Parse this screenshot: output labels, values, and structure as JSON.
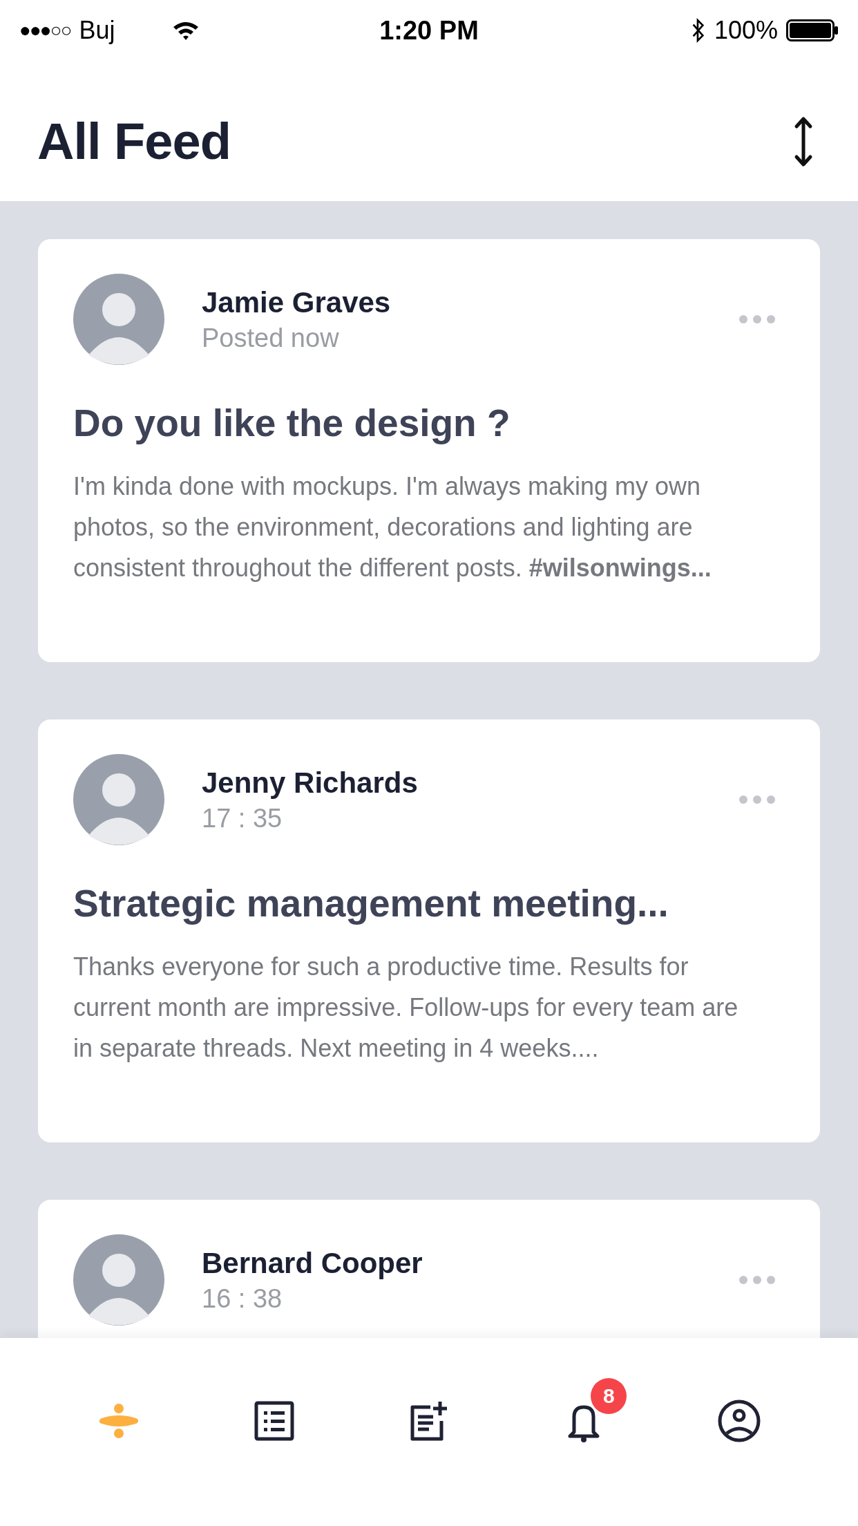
{
  "status_bar": {
    "signal_text": "●●●○○",
    "carrier": "Buj",
    "time": "1:20 PM",
    "battery": "100%"
  },
  "header": {
    "title": "All Feed"
  },
  "posts": [
    {
      "author": "Jamie Graves",
      "time": "Posted now",
      "title": "Do you like the design ?",
      "body": "I'm kinda done with mockups. I'm always making my own photos, so the environment, decorations and lighting are consistent throughout the different posts. **#wilsonwings...**"
    },
    {
      "author": "Jenny Richards",
      "time": "17 : 35",
      "title": "Strategic management meeting...",
      "body": "Thanks everyone for such a productive time. Results for current month are impressive. Follow-ups for every team are in separate threads. Next meeting in 4 weeks...."
    },
    {
      "author": "Bernard Cooper",
      "time": "16 : 38"
    }
  ],
  "nav": [
    {
      "kind": "feed",
      "selected": true
    },
    {
      "kind": "list",
      "selected": false
    },
    {
      "kind": "new-post",
      "selected": false
    },
    {
      "kind": "notifications",
      "selected": false,
      "badge": "8"
    },
    {
      "kind": "profile",
      "selected": false
    }
  ]
}
